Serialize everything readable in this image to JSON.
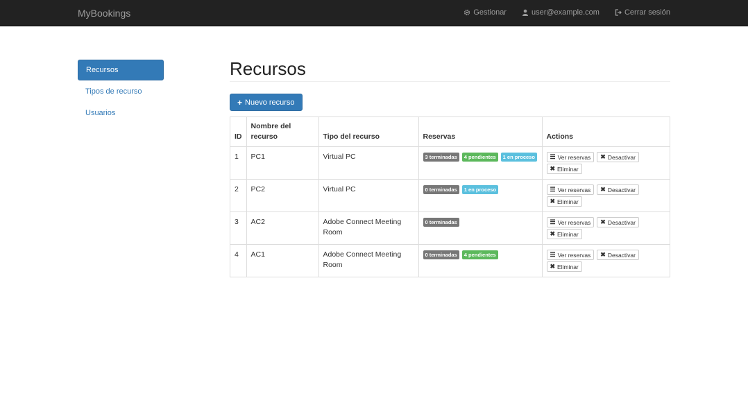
{
  "navbar": {
    "brand": "MyBookings",
    "links": [
      {
        "label": "Gestionar",
        "icon": "gear-icon"
      },
      {
        "label": "user@example.com",
        "icon": "user-icon"
      },
      {
        "label": "Cerrar sesión",
        "icon": "logout-icon"
      }
    ]
  },
  "sidebar": {
    "items": [
      {
        "label": "Recursos",
        "active": true
      },
      {
        "label": "Tipos de recurso",
        "active": false
      },
      {
        "label": "Usuarios",
        "active": false
      }
    ]
  },
  "main": {
    "title": "Recursos",
    "new_button": {
      "label": "Nuevo recurso",
      "icon": "plus-icon"
    }
  },
  "table": {
    "headers": [
      "ID",
      "Nombre del recurso",
      "Tipo del recurso",
      "Reservas",
      "Actions"
    ],
    "rows": [
      {
        "id": "1",
        "name": "PC1",
        "type": "Virtual PC",
        "badges": [
          {
            "label": "3 terminadas",
            "kind": "done"
          },
          {
            "label": "4 pendientes",
            "kind": "pending"
          },
          {
            "label": "1 en proceso",
            "kind": "process"
          }
        ]
      },
      {
        "id": "2",
        "name": "PC2",
        "type": "Virtual PC",
        "badges": [
          {
            "label": "0 terminadas",
            "kind": "done"
          },
          {
            "label": "1 en proceso",
            "kind": "process"
          }
        ]
      },
      {
        "id": "3",
        "name": "AC2",
        "type": "Adobe Connect Meeting Room",
        "badges": [
          {
            "label": "0 terminadas",
            "kind": "done"
          }
        ]
      },
      {
        "id": "4",
        "name": "AC1",
        "type": "Adobe Connect Meeting Room",
        "badges": [
          {
            "label": "0 terminadas",
            "kind": "done"
          },
          {
            "label": "4 pendientes",
            "kind": "pending"
          }
        ]
      }
    ],
    "row_actions": [
      {
        "label": "Ver reservas",
        "icon": "list-icon",
        "name": "view-bookings-button"
      },
      {
        "label": "Desactivar",
        "icon": "times-icon",
        "name": "deactivate-button"
      },
      {
        "label": "Eliminar",
        "icon": "times-icon",
        "name": "delete-button"
      }
    ]
  },
  "colors": {
    "navbar_bg": "#222222",
    "primary": "#337ab7",
    "badge_done": "#777777",
    "badge_pending": "#5cb85c",
    "badge_process": "#5bc0de"
  }
}
